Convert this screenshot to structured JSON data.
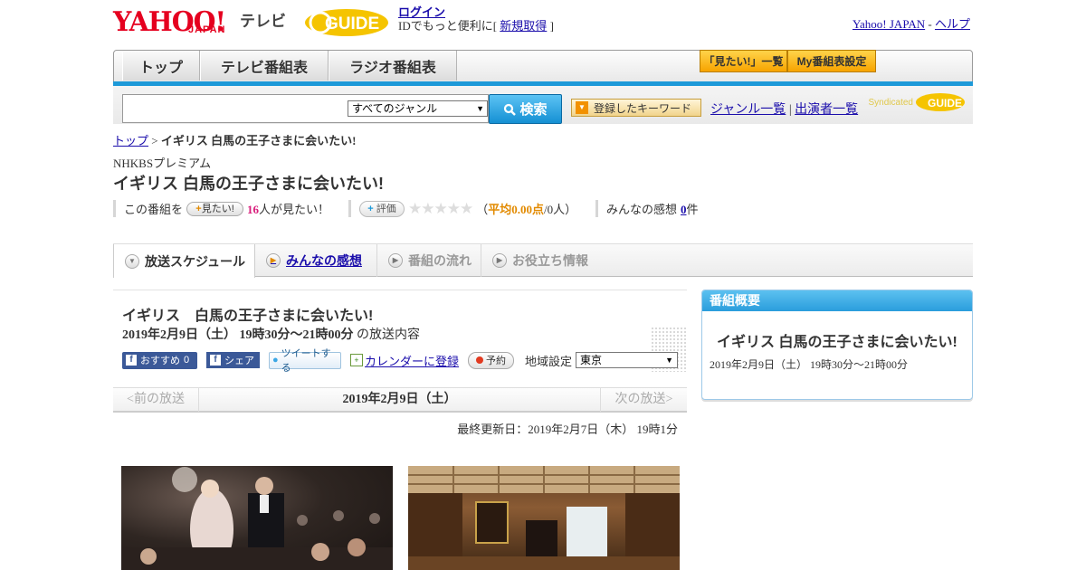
{
  "header": {
    "logo_yahoo": "YAHOO!",
    "logo_japan": "JAPAN",
    "logo_tv": "テレビ",
    "gguide_text": "GUIDE",
    "login_link": "ログイン",
    "login_text": "IDでもっと便利に[",
    "signup_link": "新規取得",
    "login_close": "]",
    "yahoo_japan_link": "Yahoo! JAPAN",
    "separator": "-",
    "help_link": "ヘルプ"
  },
  "nav": {
    "tabs": [
      {
        "label": "トップ"
      },
      {
        "label": "テレビ番組表"
      },
      {
        "label": "ラジオ番組表"
      }
    ],
    "mitai_list": "「見たい!」一覧",
    "my_bangumi": "My番組表設定"
  },
  "search": {
    "genre_selected": "すべてのジャンル",
    "button_label": "検索",
    "keyword_button": "登録したキーワード",
    "genre_list_link": "ジャンル一覧",
    "link_sep": "|",
    "performer_list_link": "出演者一覧",
    "syndicated": "Syndicated"
  },
  "breadcrumb": {
    "top": "トップ",
    "sep": ">",
    "current": "イギリス 白馬の王子さまに会いたい!"
  },
  "program": {
    "channel": "NHKBSプレミアム",
    "title": "イギリス 白馬の王子さまに会いたい!",
    "mitai_prefix": "この番組を",
    "mitai_button": "見たい!",
    "mitai_count": "16",
    "mitai_suffix": "人が見たい！",
    "hyoka_button": "評価",
    "rating_stars": "★★★★★",
    "rating_prefix": "（",
    "rating_avg": "平均0.00点",
    "rating_suffix": "/0人）",
    "kanso_prefix": "みんなの感想",
    "kanso_count": "0",
    "kanso_suffix": "件"
  },
  "tabs": [
    {
      "label": "放送スケジュール"
    },
    {
      "label": "みんなの感想"
    },
    {
      "label": "番組の流れ"
    },
    {
      "label": "お役立ち情報"
    }
  ],
  "episode": {
    "title": "イギリス　白馬の王子さまに会いたい!",
    "time": "2019年2月9日（土）  19時30分～21時00分",
    "time_suffix": "の放送内容",
    "fb_recommend": "おすすめ",
    "fb_count": "0",
    "fb_share": "シェア",
    "tweet": "ツイートする",
    "calendar": "カレンダーに登録",
    "yoyaku": "予約",
    "region_label": "地域設定",
    "region_value": "東京"
  },
  "pager": {
    "prev": "<前の放送",
    "date": "2019年2月9日（土）",
    "next": "次の放送>"
  },
  "updated": "最終更新日：2019年2月7日（木）  19時1分",
  "overview": {
    "heading": "番組概要",
    "title": "イギリス 白馬の王子さまに会いたい!",
    "time": "2019年2月9日（土）  19時30分～21時00分"
  }
}
